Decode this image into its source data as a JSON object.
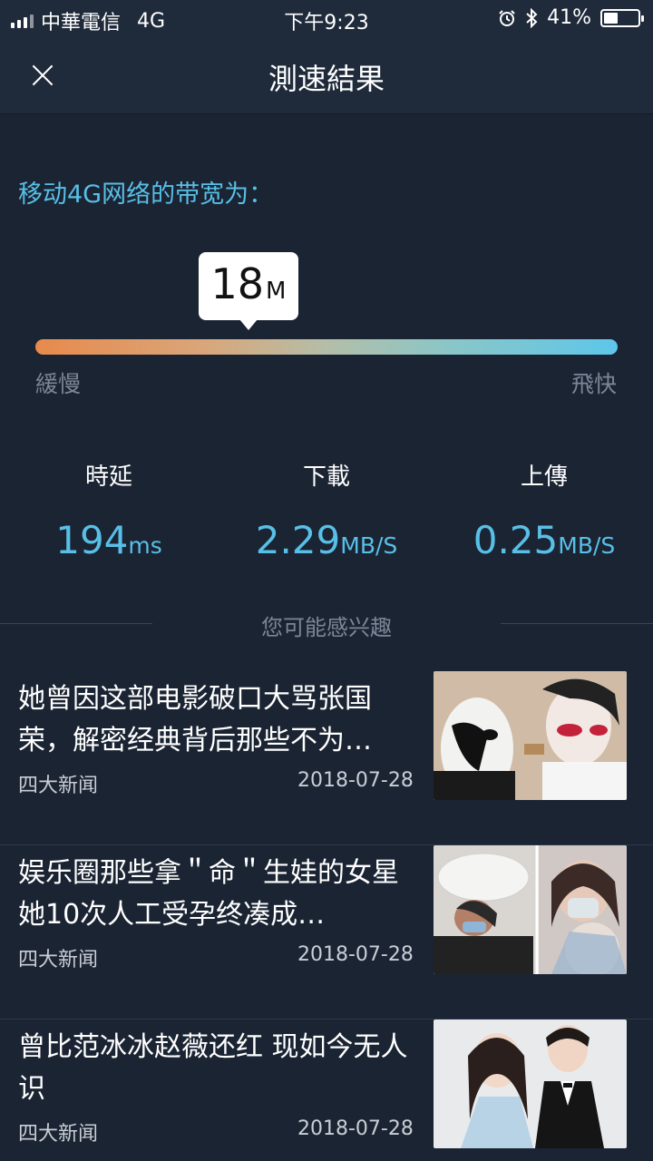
{
  "status_bar": {
    "carrier": "中華電信",
    "network": "4G",
    "time": "下午9:23",
    "battery_percent_label": "41%",
    "battery_level": 0.41,
    "icons": [
      "signal-icon",
      "alarm-icon",
      "bluetooth-icon",
      "battery-icon"
    ]
  },
  "header": {
    "title": "測速結果",
    "close_icon": "close-icon"
  },
  "bandwidth": {
    "label": "移动4G网络的带宽为：",
    "value": "18",
    "unit": "M",
    "bar_gradient": [
      "#e88a4c",
      "#5ec6ea"
    ],
    "slow_label": "緩慢",
    "fast_label": "飛快"
  },
  "metrics": [
    {
      "label": "時延",
      "value": "194",
      "unit": "ms"
    },
    {
      "label": "下載",
      "value": "2.29",
      "unit": "MB/S"
    },
    {
      "label": "上傳",
      "value": "0.25",
      "unit": "MB/S"
    }
  ],
  "interest_label": "您可能感兴趣",
  "news": [
    {
      "title": "她曾因这部电影破口大骂张国荣，解密经典背后那些不为…",
      "source": "四大新闻",
      "date": "2018-07-28"
    },
    {
      "title": "娱乐圈那些拿＂命＂生娃的女星 她10次人工受孕终凑成…",
      "source": "四大新闻",
      "date": "2018-07-28"
    },
    {
      "title": "曾比范冰冰赵薇还红 现如今无人识",
      "source": "四大新闻",
      "date": "2018-07-28"
    }
  ],
  "colors": {
    "background": "#1b2433",
    "accent": "#58bfe6",
    "muted": "#7c8696"
  }
}
